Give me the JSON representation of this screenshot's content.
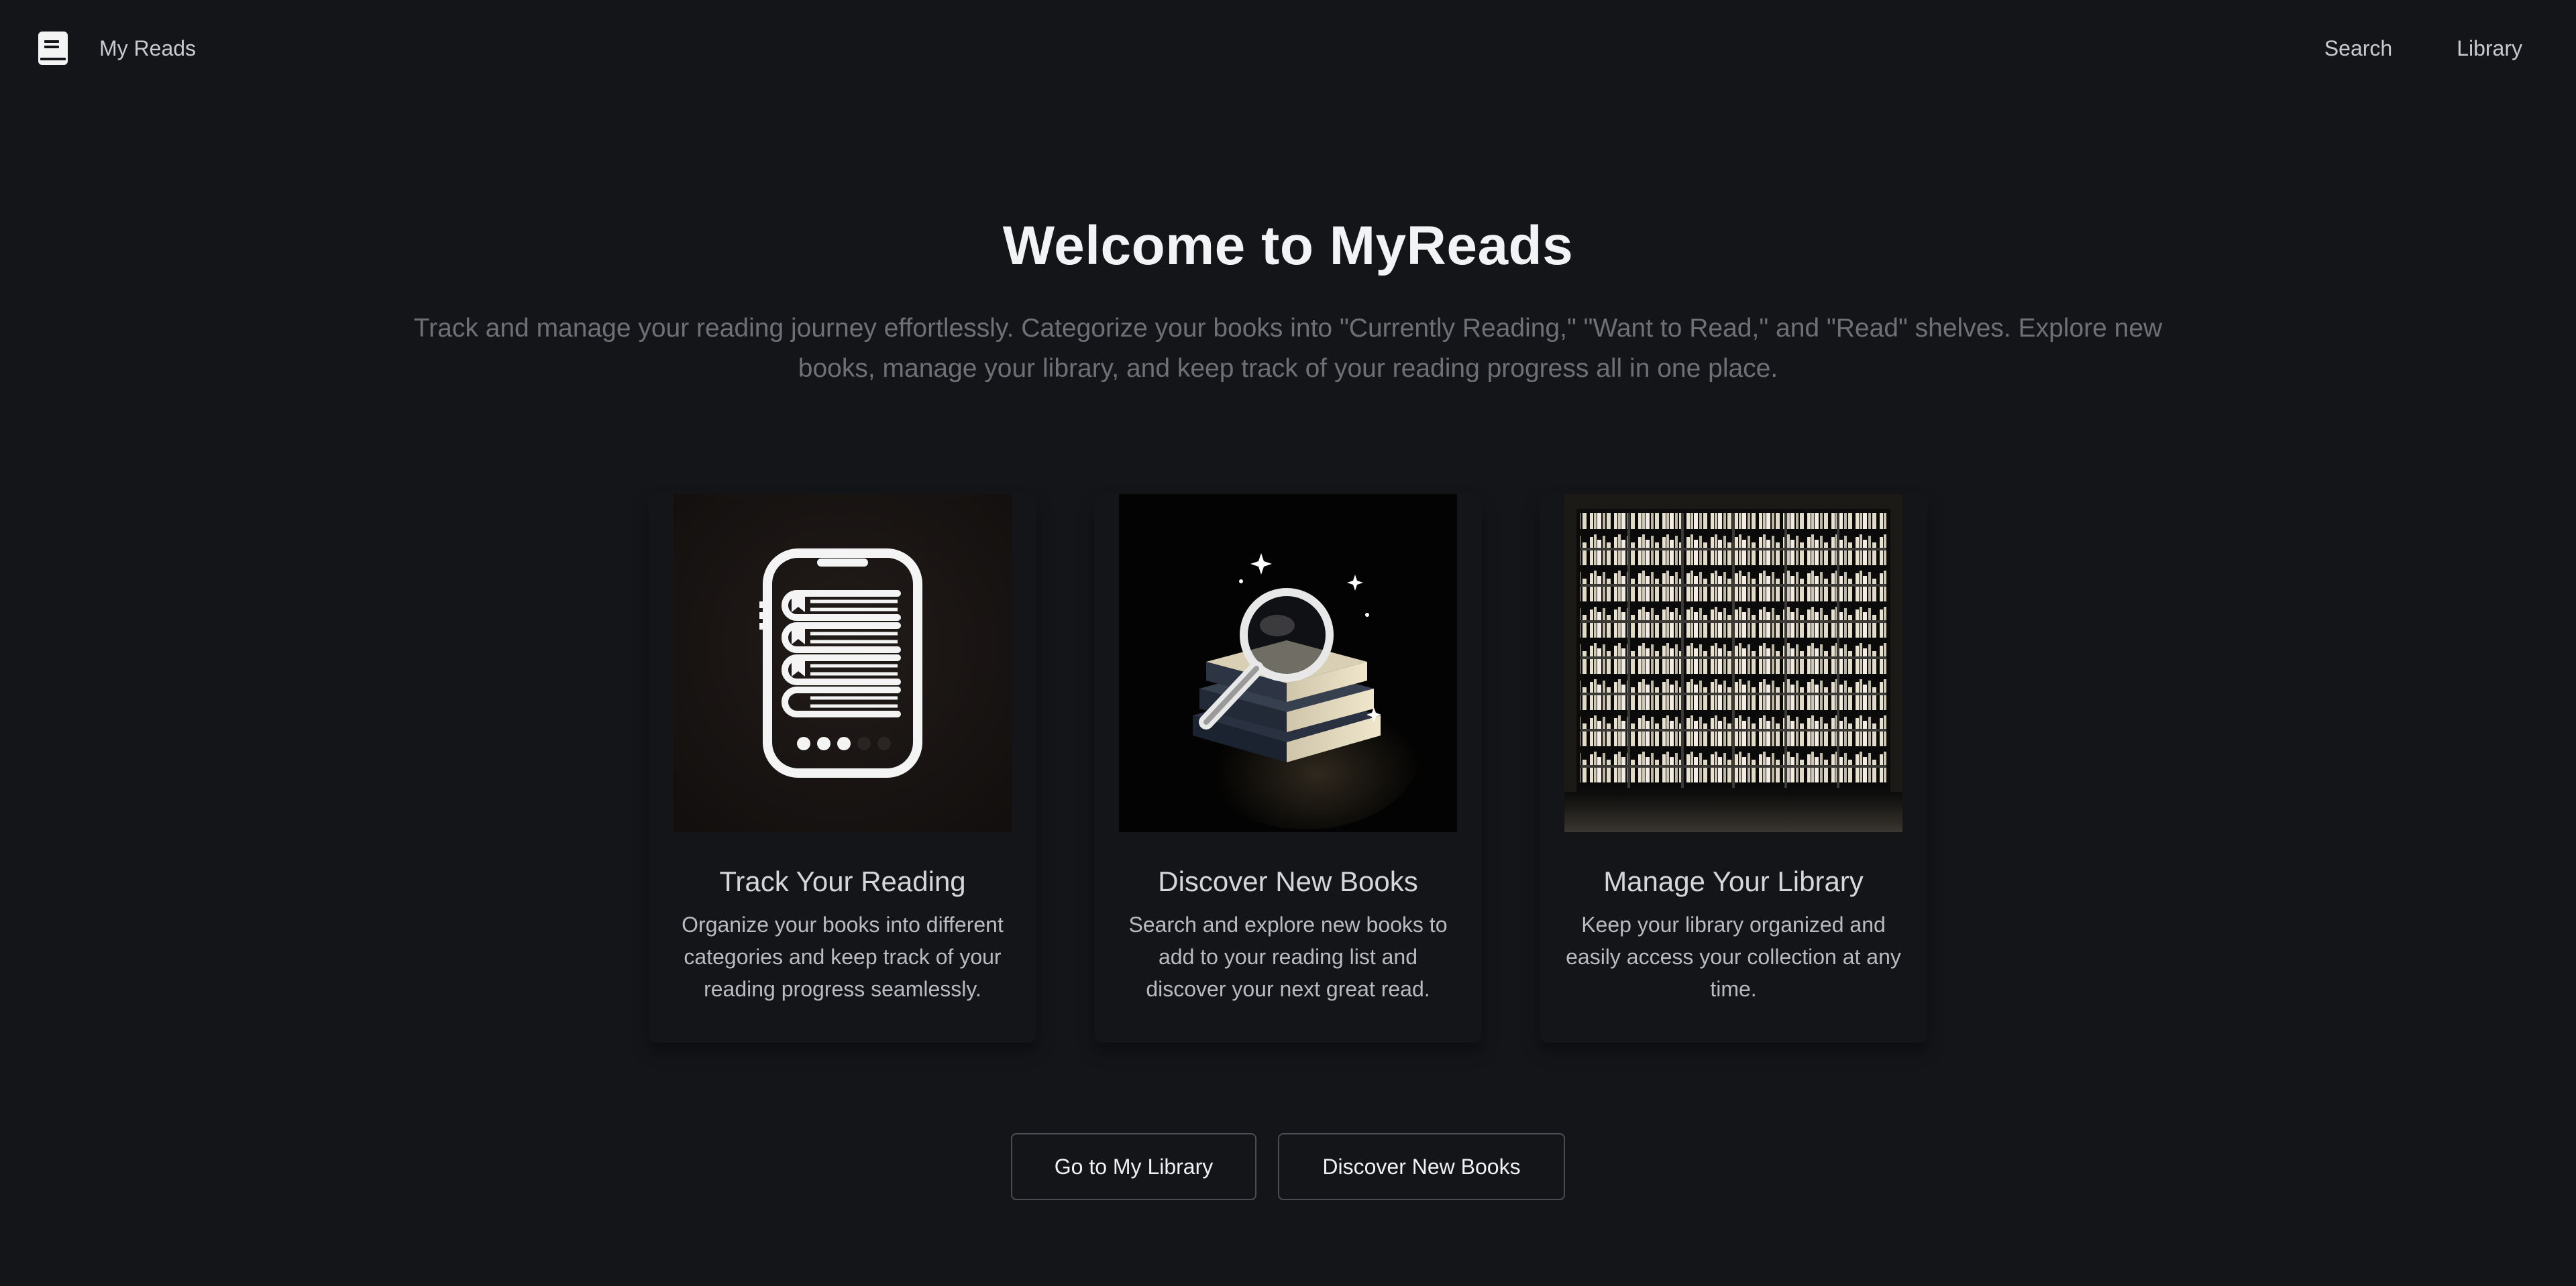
{
  "header": {
    "brand_label": "My Reads",
    "nav": [
      {
        "label": "Search"
      },
      {
        "label": "Library"
      }
    ]
  },
  "hero": {
    "title": "Welcome to MyReads",
    "description": "Track and manage your reading journey effortlessly. Categorize your books into \"Currently Reading,\" \"Want to Read,\" and \"Read\" shelves. Explore new books, manage your library, and keep track of your reading progress all in one place."
  },
  "features": [
    {
      "title": "Track Your Reading",
      "description": "Organize your books into different categories and keep track of your reading progress seamlessly.",
      "image_icon": "phone-with-books-icon"
    },
    {
      "title": "Discover New Books",
      "description": "Search and explore new books to add to your reading list and discover your next great read.",
      "image_icon": "magnifier-over-books-icon"
    },
    {
      "title": "Manage Your Library",
      "description": "Keep your library organized and easily access your collection at any time.",
      "image_icon": "bookshelf-icon"
    }
  ],
  "cta": {
    "library_label": "Go to My Library",
    "discover_label": "Discover New Books"
  },
  "colors": {
    "background": "#141518",
    "text_primary": "#f2f3f5",
    "text_muted": "#6e7076",
    "button_border": "#4a4c52"
  }
}
